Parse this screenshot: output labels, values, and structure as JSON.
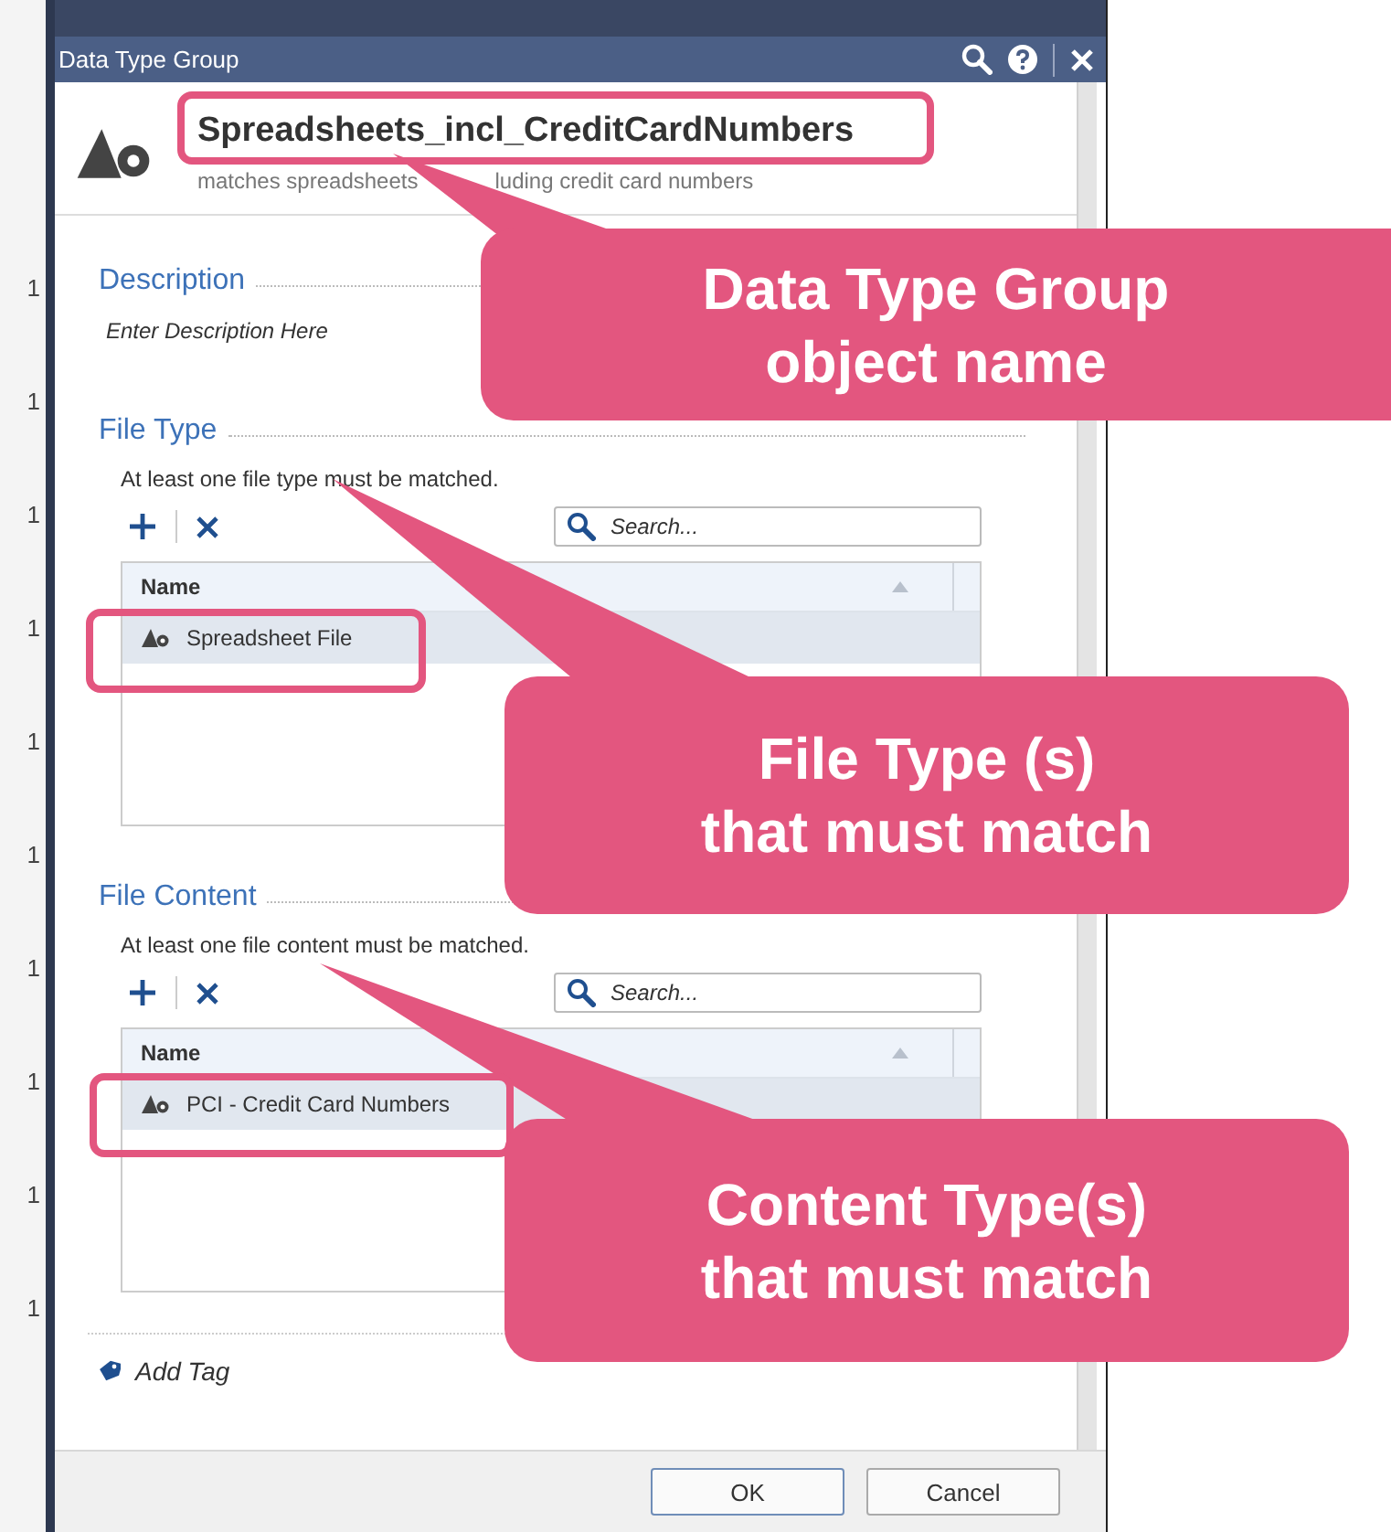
{
  "background_app": {
    "row_marks": [
      "1",
      "1",
      "1",
      "1",
      "1",
      "1",
      "1",
      "1",
      "1",
      "1"
    ]
  },
  "dialog": {
    "title": "Data Type Group",
    "header": {
      "name": "Spreadsheets_incl_CreditCardNumbers",
      "subtitle_parts": [
        "matches spreadsheets",
        "luding credit card numbers"
      ]
    },
    "description": {
      "heading": "Description",
      "placeholder": "Enter Description Here"
    },
    "sections": [
      {
        "heading": "File Type",
        "note": "At least one file type must be matched.",
        "search": {
          "placeholder": "Search..."
        },
        "columns": [
          "Name"
        ],
        "rows": [
          {
            "name": "Spreadsheet File",
            "selected": true
          }
        ]
      },
      {
        "heading": "File Content",
        "note": "At least one file content must be matched.",
        "search": {
          "placeholder": "Search..."
        },
        "columns": [
          "Name"
        ],
        "rows": [
          {
            "name": "PCI - Credit Card Numbers",
            "selected": true
          }
        ]
      }
    ],
    "add_tag": "Add Tag",
    "buttons": [
      {
        "label": "OK",
        "kind": "default"
      },
      {
        "label": "Cancel",
        "kind": "normal"
      }
    ]
  },
  "callouts": [
    {
      "lines": [
        "Data Type Group",
        "object name"
      ]
    },
    {
      "lines": [
        "File Type (s)",
        "that must match"
      ]
    },
    {
      "lines": [
        "Content Type(s)",
        "that must match"
      ]
    }
  ]
}
